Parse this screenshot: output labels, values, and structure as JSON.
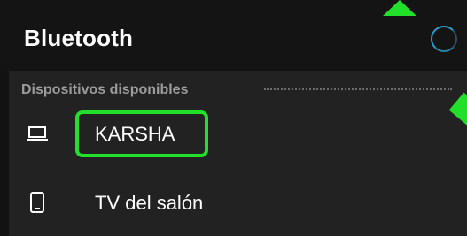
{
  "header": {
    "title": "Bluetooth",
    "spinner_icon": "loading-spinner-icon",
    "accent_color": "#2c9ac9"
  },
  "devices_section": {
    "heading": "Dispositivos disponibles",
    "items": [
      {
        "label": "KARSHA",
        "icon": "laptop-icon",
        "highlighted": true
      },
      {
        "label": "TV del salón",
        "icon": "phone-icon",
        "highlighted": false
      }
    ]
  },
  "annotation_color": "#22e02a"
}
